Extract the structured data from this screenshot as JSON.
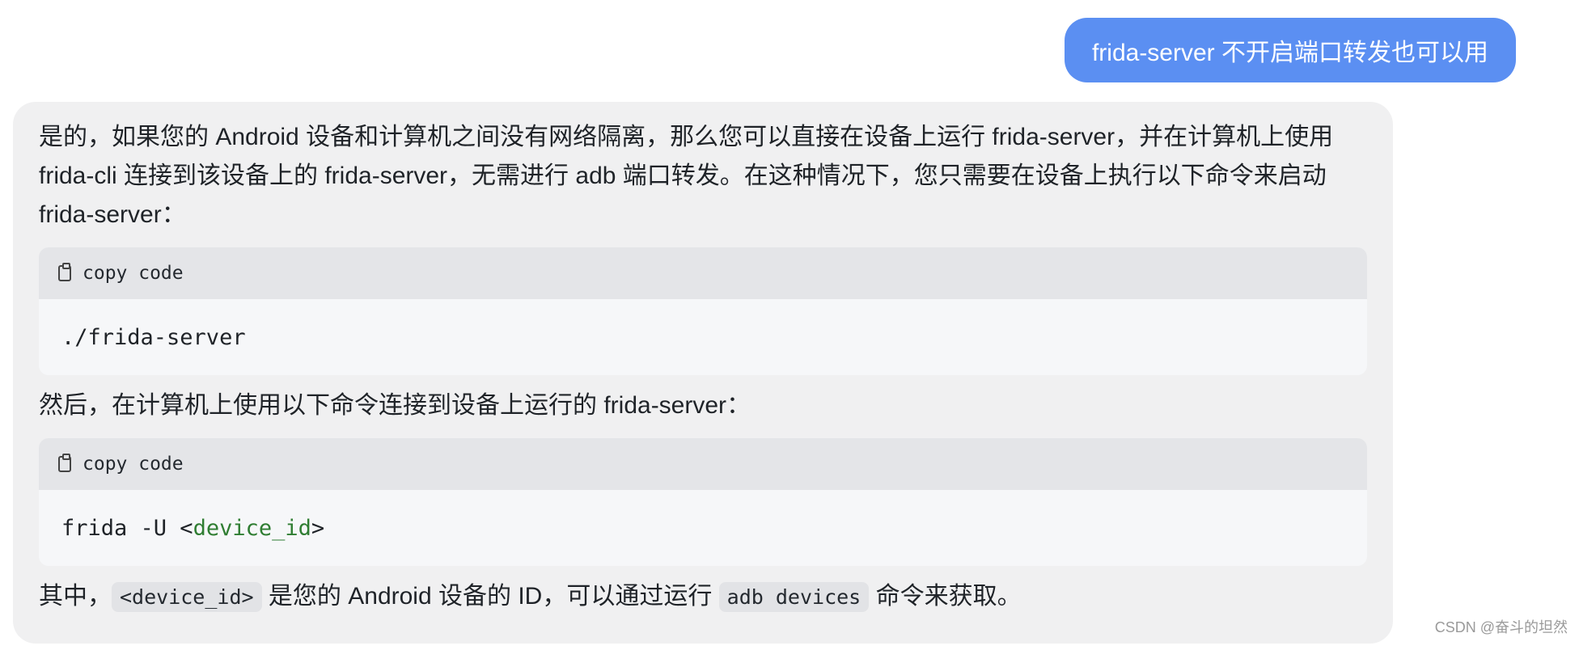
{
  "user_message": {
    "text": "frida-server 不开启端口转发也可以用"
  },
  "assistant_message": {
    "paragraph_1": "是的，如果您的 Android 设备和计算机之间没有网络隔离，那么您可以直接在设备上运行 frida-server，并在计算机上使用 frida-cli 连接到该设备上的 frida-server，无需进行 adb 端口转发。在这种情况下，您只需要在设备上执行以下命令来启动 frida-server：",
    "code_block_1": {
      "copy_label": "copy code",
      "code": "./frida-server"
    },
    "paragraph_2": "然后，在计算机上使用以下命令连接到设备上运行的 frida-server：",
    "code_block_2": {
      "copy_label": "copy code",
      "code_prefix": "frida -U <",
      "code_placeholder": "device_id",
      "code_suffix": ">"
    },
    "paragraph_3": {
      "prefix": "其中，",
      "inline_code_1": "<device_id>",
      "middle": " 是您的 Android 设备的 ID，可以通过运行 ",
      "inline_code_2": "adb devices",
      "suffix": " 命令来获取。"
    }
  },
  "watermark": "CSDN @奋斗的坦然",
  "colors": {
    "user_bubble": "#5b8ff2",
    "assistant_bubble": "#f0f0f1",
    "code_header": "#e4e5e8",
    "code_body": "#f6f7f9",
    "code_placeholder": "#2f7d32"
  },
  "icons": {
    "copy": "clipboard-icon"
  }
}
